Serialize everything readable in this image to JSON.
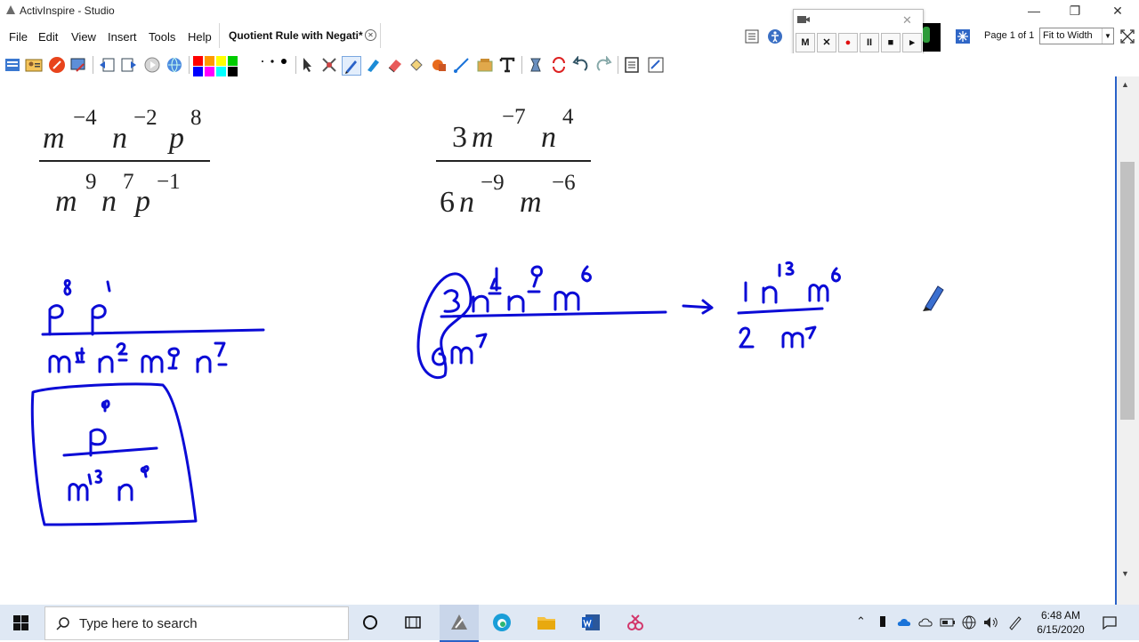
{
  "window": {
    "title": "ActivInspire - Studio",
    "controls": {
      "minimize": "—",
      "restore": "❐",
      "close": "✕"
    }
  },
  "menu": [
    "File",
    "Edit",
    "View",
    "Insert",
    "Tools",
    "Help"
  ],
  "document_tab": {
    "label": "Quotient Rule with Negati*"
  },
  "page_indicator": "Page 1 of 1",
  "zoom_select": {
    "value": "Fit to Width"
  },
  "recorder": {
    "buttons": [
      "M",
      "✕",
      "●",
      "II",
      "■",
      "▸"
    ]
  },
  "toolbar": {
    "palette": [
      "#ff0000",
      "#ff9900",
      "#ffff00",
      "#00cc00",
      "#0000ff",
      "#ff00ff",
      "#00ffff",
      "#000000"
    ],
    "accent": "#1a73d9"
  },
  "canvas": {
    "ink_color": "#0b0bd6",
    "problem1": {
      "numerator": {
        "t1": "m",
        "e1": "−4",
        "t2": "n",
        "e2": "−2",
        "t3": "p",
        "e3": "8"
      },
      "denominator": {
        "t1": "m",
        "e1": "9",
        "t2": "n",
        "e2": "7",
        "t3": "p",
        "e3": "−1"
      }
    },
    "problem2": {
      "numerator": {
        "c": "3",
        "t1": "m",
        "e1": "−7",
        "t2": "n",
        "e2": "4"
      },
      "denominator": {
        "c": "6",
        "t1": "n",
        "e1": "−9",
        "t2": "m",
        "e2": "−6"
      }
    }
  },
  "taskbar": {
    "search_placeholder": "Type here to search",
    "time": "6:48 AM",
    "date": "6/15/2020"
  }
}
